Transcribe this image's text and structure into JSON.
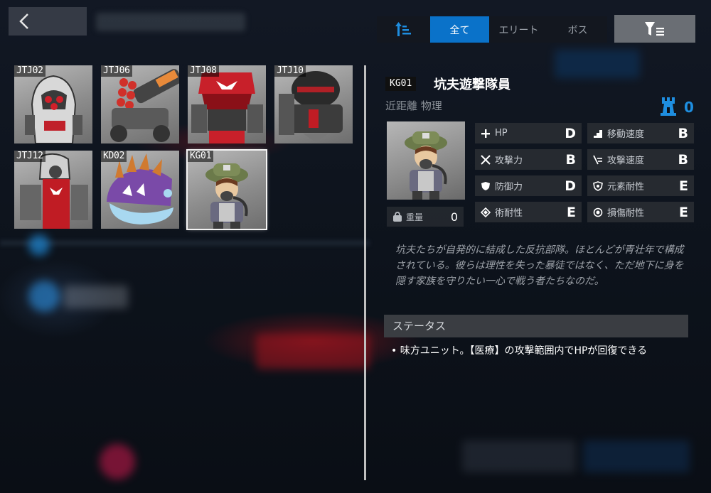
{
  "header": {
    "back_label": "back"
  },
  "tabs": [
    {
      "id": "sort",
      "label": "",
      "icon": "sort-icon"
    },
    {
      "id": "all",
      "label": "全て",
      "active": true
    },
    {
      "id": "elite",
      "label": "エリート"
    },
    {
      "id": "boss",
      "label": "ボス"
    }
  ],
  "filter_icon": "filter-list-icon",
  "enemies": [
    {
      "code": "JTJ02",
      "color": "#c0202a"
    },
    {
      "code": "JTJ06",
      "color": "#d43a2c"
    },
    {
      "code": "JTJ08",
      "color": "#c8202a"
    },
    {
      "code": "JTJ10",
      "color": "#b82a26"
    },
    {
      "code": "JTJ12",
      "color": "#c01c24"
    },
    {
      "code": "KD02",
      "color": "#8a5cc0"
    },
    {
      "code": "KG01",
      "color": "#6b7a4a",
      "selected": true
    }
  ],
  "detail": {
    "code": "KG01",
    "name": "坑夫遊撃隊員",
    "attributes": "近距離 物理",
    "tower_value": "0",
    "weight_label": "重量",
    "weight_value": "0",
    "stats": [
      {
        "label": "HP",
        "grade": "D",
        "icon": "plus-icon"
      },
      {
        "label": "移動速度",
        "grade": "B",
        "icon": "stairs-icon"
      },
      {
        "label": "攻撃力",
        "grade": "B",
        "icon": "crossed-swords-icon"
      },
      {
        "label": "攻撃速度",
        "grade": "B",
        "icon": "speed-lines-icon"
      },
      {
        "label": "防御力",
        "grade": "D",
        "icon": "shield-icon"
      },
      {
        "label": "元素耐性",
        "grade": "E",
        "icon": "element-shield-icon"
      },
      {
        "label": "術耐性",
        "grade": "E",
        "icon": "arts-diamond-icon"
      },
      {
        "label": "損傷耐性",
        "grade": "E",
        "icon": "damage-ring-icon"
      }
    ],
    "description": "坑夫たちが自発的に結成した反抗部隊。ほとんどが青壮年で構成されている。彼らは理性を失った暴徒ではなく、ただ地下に身を隠す家族を守りたい一心で戦う者たちなのだ。",
    "status_header": "ステータス",
    "status_items": [
      "味方ユニット。【医療】の攻撃範囲内でHPが回復できる"
    ]
  },
  "colors": {
    "accent": "#0a72c9",
    "tower": "#1e8ee0"
  }
}
